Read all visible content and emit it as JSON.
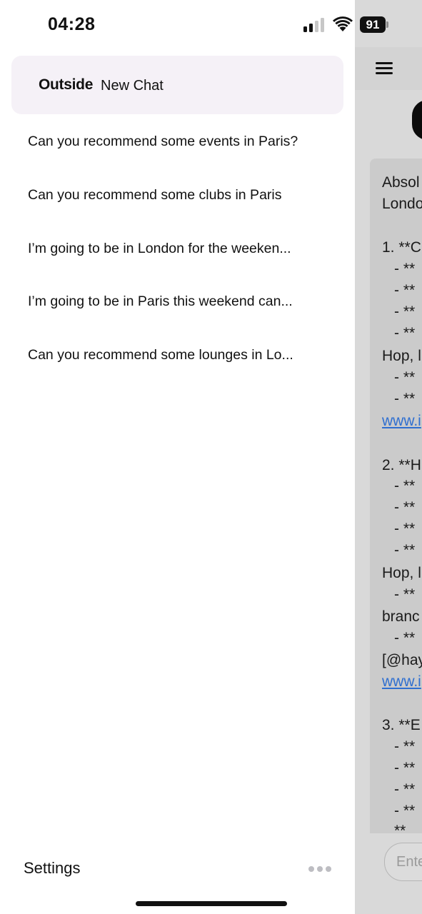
{
  "status_bar": {
    "time": "04:28",
    "battery": "91"
  },
  "drawer": {
    "brand": "Outside",
    "new_chat": "New Chat",
    "history": [
      "Can you recommend some events in Paris?",
      "Can you recommend some clubs in Paris",
      "I’m going to be in London for the weeken...",
      "I’m going to be in Paris this weekend can...",
      "Can you recommend some lounges in Lo..."
    ],
    "settings": "Settings"
  },
  "chat": {
    "message_lines": [
      "Absol",
      "Londo",
      "",
      "1. **C",
      "  - **",
      "  - **",
      "  - **",
      "  - **",
      "Hop, l",
      "  - **",
      "  - **",
      "www.i",
      "",
      "2. **H",
      "  - **",
      "  - **",
      "  - **",
      "  - **",
      "Hop, l",
      "  - **",
      "branc",
      "  - **",
      "[@hay",
      "www.i",
      "",
      "3. **E",
      "  - **",
      "  - **",
      "  - **",
      "  - **",
      "  **"
    ],
    "input_placeholder": "Ente"
  }
}
